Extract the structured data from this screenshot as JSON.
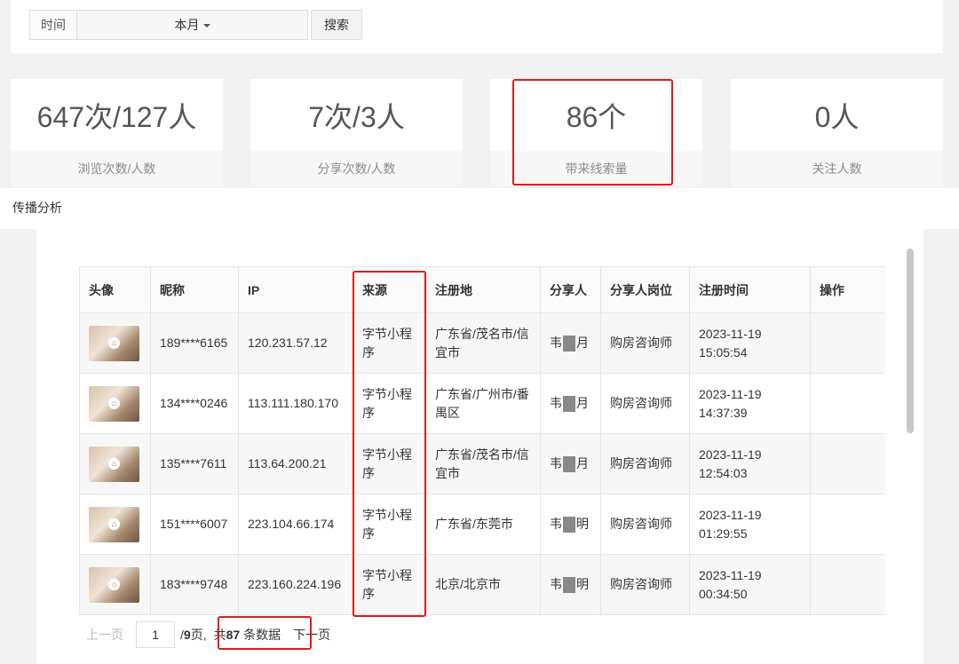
{
  "filter": {
    "label": "时间",
    "selected": "本月",
    "search_button": "搜索"
  },
  "stats": [
    {
      "value": "647次/127人",
      "label": "浏览次数/人数"
    },
    {
      "value": "7次/3人",
      "label": "分享次数/人数"
    },
    {
      "value": "86个",
      "label": "带来线索量"
    },
    {
      "value": "0人",
      "label": "关注人数"
    }
  ],
  "section_title": "传播分析",
  "table": {
    "headers": [
      "头像",
      "昵称",
      "IP",
      "来源",
      "注册地",
      "分享人",
      "分享人岗位",
      "注册时间",
      "操作"
    ],
    "rows": [
      {
        "nickname": "189****6165",
        "ip": "120.231.57.12",
        "source": "字节小程序",
        "region": "广东省/茂名市/信宜市",
        "sharer_a": "韦",
        "sharer_b": "月",
        "position": "购房咨询师",
        "time": "2023-11-19 15:05:54"
      },
      {
        "nickname": "134****0246",
        "ip": "113.111.180.170",
        "source": "字节小程序",
        "region": "广东省/广州市/番禺区",
        "sharer_a": "韦",
        "sharer_b": "月",
        "position": "购房咨询师",
        "time": "2023-11-19 14:37:39"
      },
      {
        "nickname": "135****7611",
        "ip": "113.64.200.21",
        "source": "字节小程序",
        "region": "广东省/茂名市/信宜市",
        "sharer_a": "韦",
        "sharer_b": "月",
        "position": "购房咨询师",
        "time": "2023-11-19 12:54:03"
      },
      {
        "nickname": "151****6007",
        "ip": "223.104.66.174",
        "source": "字节小程序",
        "region": "广东省/东莞市",
        "sharer_a": "韦",
        "sharer_b": "明",
        "position": "购房咨询师",
        "time": "2023-11-19 01:29:55"
      },
      {
        "nickname": "183****9748",
        "ip": "223.160.224.196",
        "source": "字节小程序",
        "region": "北京/北京市",
        "sharer_a": "韦",
        "sharer_b": "明",
        "position": "购房咨询师",
        "time": "2023-11-19 00:34:50"
      }
    ]
  },
  "pagination": {
    "prev": "上一页",
    "current_page": "1",
    "total_pages_prefix": "/",
    "total_pages": "9",
    "total_pages_suffix": "页,",
    "total_prefix": "共",
    "total_count": "87",
    "total_suffix": "条数据",
    "next": "下一页"
  },
  "colors": {
    "highlight": "#e11b1b",
    "page_bg": "#f2f2f2"
  }
}
